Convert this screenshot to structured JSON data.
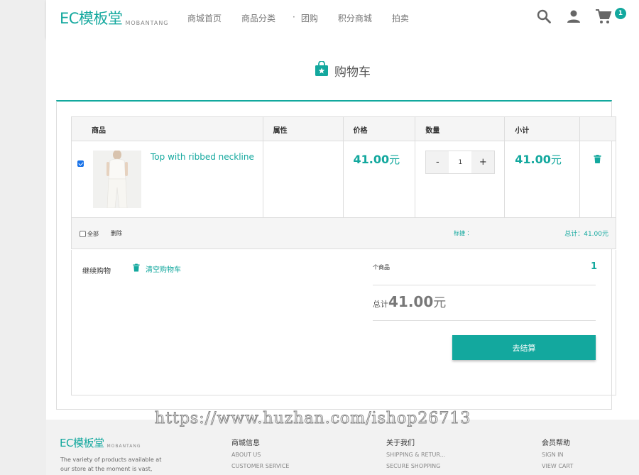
{
  "header": {
    "logo_main": "EC模板堂",
    "logo_sub": "MOBANTANG",
    "nav": [
      "商城首页",
      "商品分类",
      "团购",
      "积分商城",
      "拍卖"
    ],
    "nav_dot": "·",
    "cart_count": "1"
  },
  "page": {
    "title": "购物车"
  },
  "table": {
    "headers": [
      "商品",
      "属性",
      "价格",
      "数量",
      "小计"
    ],
    "rows": [
      {
        "name": "Top with ribbed neckline",
        "price": "41.00",
        "price_unit": "元",
        "qty_minus": "-",
        "qty": "1",
        "qty_plus": "+",
        "subtotal": "41.00",
        "subtotal_unit": "元"
      }
    ],
    "footer": {
      "select_all": "全部",
      "delete": "删除",
      "mark": "标捷 ：",
      "total": "总计：41.00元"
    }
  },
  "summary": {
    "continue": "继续购物",
    "clear": "清空购物车",
    "count_label": "个商品",
    "count": "1",
    "total_label": "总计",
    "total": "41.00",
    "total_unit": "元",
    "checkout": "去结算"
  },
  "footer": {
    "logo_main": "EC模板堂",
    "logo_sub": "MOBANTANG",
    "desc_1": "The variety of products available at",
    "desc_2": "our store at the moment is vast, but",
    "cols": [
      {
        "title": "商城信息",
        "links": [
          "ABOUT US",
          "CUSTOMER SERVICE"
        ]
      },
      {
        "title": "关于我们",
        "links": [
          "SHIPPING & RETUR...",
          "SECURE SHOPPING"
        ]
      },
      {
        "title": "会员帮助",
        "links": [
          "SIGN IN",
          "VIEW CART"
        ]
      }
    ]
  },
  "watermark": "https://www.huzhan.com/ishop26713",
  "colors": {
    "accent": "#13a89e",
    "checkbox": "#1a73e8"
  }
}
